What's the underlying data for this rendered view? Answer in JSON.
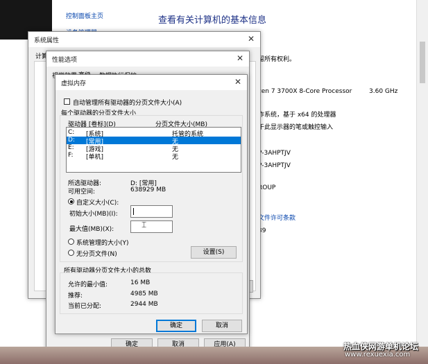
{
  "sysinfo": {
    "control_panel_home": "控制面板主页",
    "device_manager": "设备管理器",
    "heading": "查看有关计算机的基本信息",
    "rights": "留所有权利。",
    "processor": "zen 7 3700X 8-Core Processor",
    "cpu_speed": "3.60 GHz",
    "system_type": "作系统，基于 x64 的处理器",
    "pen_touch": "于此显示器的笔或触控输入",
    "computer_name": "P-3AHPTJV",
    "full_name": "P-3AHPTJV",
    "workgroup": "ROUP",
    "license_link": "文件许可条款",
    "product_id": "39"
  },
  "sys_props": {
    "title": "系统属性",
    "tab_partial": "计算"
  },
  "perf_opts": {
    "title": "性能选项",
    "tabs": [
      "视觉效果",
      "高级",
      "数据执行保护"
    ],
    "ok": "确定",
    "cancel": "取消",
    "apply": "应用(A)"
  },
  "vm": {
    "title": "虚拟内存",
    "auto_manage": "自动管理所有驱动器的分页文件大小(A)",
    "group_title": "每个驱动器的分页文件大小",
    "col_drive": "驱动器 [卷标](D)",
    "col_size": "分页文件大小(MB)",
    "drives": [
      {
        "drive": "C:",
        "label": "[系统]",
        "size": "托管的系统"
      },
      {
        "drive": "D:",
        "label": "[常用]",
        "size": "无"
      },
      {
        "drive": "E:",
        "label": "[游戏]",
        "size": "无"
      },
      {
        "drive": "F:",
        "label": "[单机]",
        "size": "无"
      }
    ],
    "selected_drive_label": "所选驱动器:",
    "selected_drive_value": "D:  [常用]",
    "free_space_label": "可用空间:",
    "free_space_value": "638929 MB",
    "custom_size": "自定义大小(C):",
    "initial_size_label": "初始大小(MB)(I):",
    "initial_size_value": "",
    "max_size_label": "最大值(MB)(X):",
    "max_size_value": "",
    "system_managed": "系统管理的大小(Y)",
    "no_paging": "无分页文件(N)",
    "set_button": "设置(S)",
    "total_group_title": "所有驱动器分页文件大小的总数",
    "min_allowed_label": "允许的最小值:",
    "min_allowed_value": "16 MB",
    "recommended_label": "推荐:",
    "recommended_value": "4985 MB",
    "current_label": "当前已分配:",
    "current_value": "2944 MB",
    "ok": "确定",
    "cancel": "取消"
  },
  "watermark": {
    "line1": "热血侠网游单机论坛",
    "line2": "www.rexuexia.com"
  },
  "colors": {
    "selection": "#0078d7",
    "link": "#0645ad"
  }
}
